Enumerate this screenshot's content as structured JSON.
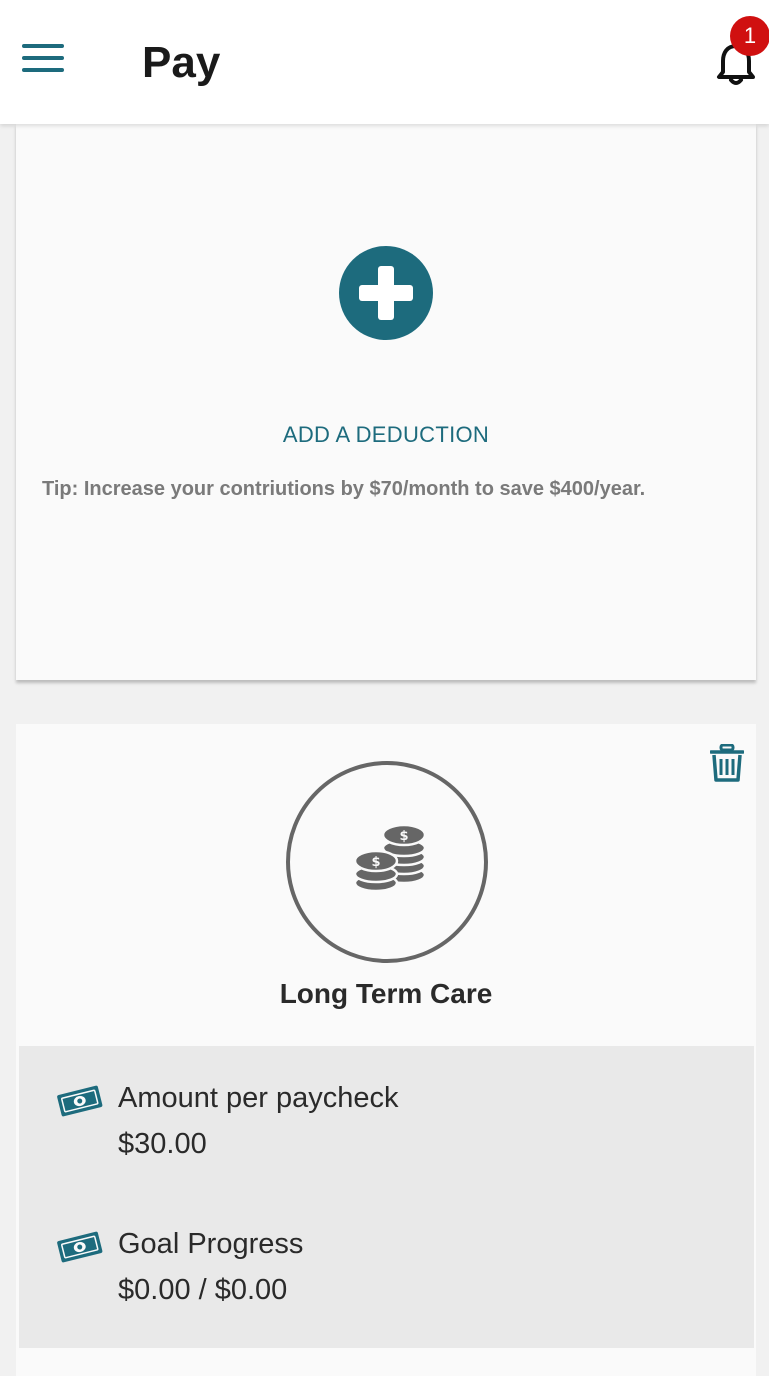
{
  "header": {
    "title": "Pay",
    "notification_count": "1",
    "menu_icon": "hamburger-menu-icon",
    "bell_icon": "bell-icon"
  },
  "add_card": {
    "add_icon": "plus-circle-icon",
    "add_label": "ADD A DEDUCTION",
    "tip": "Tip: Increase your contriutions by $70/month to save $400/year."
  },
  "deduction": {
    "delete_icon": "trash-icon",
    "category_icon": "coins-icon",
    "name": "Long Term Care",
    "amount_label": "Amount per paycheck",
    "amount_value": "$30.00",
    "goal_label": "Goal Progress",
    "goal_value": "$0.00 / $0.00"
  },
  "colors": {
    "accent": "#1d6b7d",
    "badge": "#d01010",
    "details_bg": "#e9e9e9"
  }
}
